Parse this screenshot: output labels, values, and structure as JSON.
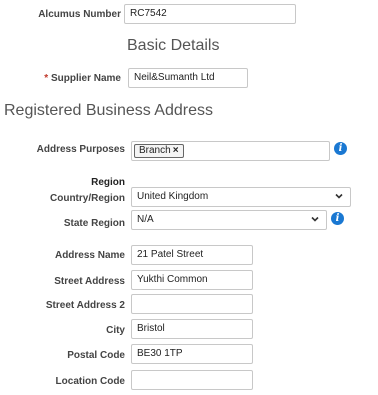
{
  "alcumus": {
    "label": "Alcumus Number",
    "value": "RC7542"
  },
  "basic_details": {
    "heading": "Basic Details",
    "required_mark": "*",
    "supplier_label": "Supplier Name",
    "supplier_value": "Neil&Sumanth Ltd"
  },
  "address": {
    "heading": "Registered Business Address",
    "purposes_label": "Address Purposes",
    "purpose_tag": "Branch",
    "tag_remove_glyph": "×",
    "region_heading": "Region",
    "country_label": "Country/Region",
    "country_value": "United Kingdom",
    "state_label": "State Region",
    "state_value": "N/A",
    "name_label": "Address Name",
    "name_value": "21 Patel Street",
    "street_label": "Street Address",
    "street_value": "Yukthi Common",
    "street2_label": "Street Address 2",
    "street2_value": "",
    "city_label": "City",
    "city_value": "Bristol",
    "postal_label": "Postal Code",
    "postal_value": "BE30 1TP",
    "location_label": "Location Code",
    "location_value": ""
  },
  "icons": {
    "info": "info-icon",
    "chevron": "chevron-down-icon",
    "info_glyph": "i"
  },
  "colors": {
    "info_blue": "#1a78d2",
    "required_red": "#c0392b"
  }
}
